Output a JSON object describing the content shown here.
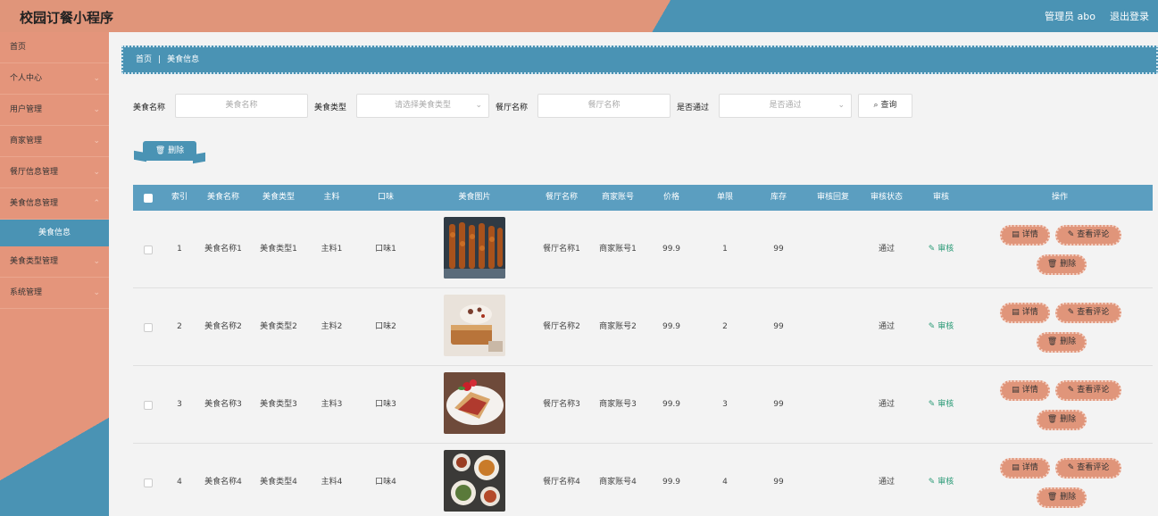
{
  "header": {
    "title": "校园订餐小程序",
    "admin": "管理员 abo",
    "logout": "退出登录"
  },
  "sidebar": {
    "items": [
      {
        "label": "首页",
        "chevron": false
      },
      {
        "label": "个人中心",
        "chevron": true
      },
      {
        "label": "用户管理",
        "chevron": true
      },
      {
        "label": "商家管理",
        "chevron": true
      },
      {
        "label": "餐厅信息管理",
        "chevron": true
      },
      {
        "label": "美食信息管理",
        "chevron": true
      }
    ],
    "active_sub": "美食信息",
    "items_after": [
      {
        "label": "美食类型管理",
        "chevron": true
      },
      {
        "label": "系统管理",
        "chevron": true
      }
    ]
  },
  "breadcrumb": {
    "home": "首页",
    "current": "美食信息"
  },
  "search": {
    "food_name_label": "美食名称",
    "food_name_placeholder": "美食名称",
    "food_type_label": "美食类型",
    "food_type_placeholder": "请选择美食类型",
    "restaurant_label": "餐厅名称",
    "restaurant_placeholder": "餐厅名称",
    "approved_label": "是否通过",
    "approved_placeholder": "是否通过",
    "query_label": "查询"
  },
  "delete_label": "删除",
  "table": {
    "headers": [
      "索引",
      "美食名称",
      "美食类型",
      "主料",
      "口味",
      "美食图片",
      "餐厅名称",
      "商家账号",
      "价格",
      "单限",
      "库存",
      "审核回复",
      "审核状态",
      "审核",
      "操作"
    ],
    "audit_label": "审核",
    "detail_label": "详情",
    "review_label": "查看评论",
    "delete_label": "删除",
    "rows": [
      {
        "index": "1",
        "name": "美食名称1",
        "type": "美食类型1",
        "main": "主料1",
        "taste": "口味1",
        "restaurant": "餐厅名称1",
        "account": "商家账号1",
        "price": "99.9",
        "limit": "1",
        "stock": "99",
        "reply": "",
        "status": "通过"
      },
      {
        "index": "2",
        "name": "美食名称2",
        "type": "美食类型2",
        "main": "主料2",
        "taste": "口味2",
        "restaurant": "餐厅名称2",
        "account": "商家账号2",
        "price": "99.9",
        "limit": "2",
        "stock": "99",
        "reply": "",
        "status": "通过"
      },
      {
        "index": "3",
        "name": "美食名称3",
        "type": "美食类型3",
        "main": "主料3",
        "taste": "口味3",
        "restaurant": "餐厅名称3",
        "account": "商家账号3",
        "price": "99.9",
        "limit": "3",
        "stock": "99",
        "reply": "",
        "status": "通过"
      },
      {
        "index": "4",
        "name": "美食名称4",
        "type": "美食类型4",
        "main": "主料4",
        "taste": "口味4",
        "restaurant": "餐厅名称4",
        "account": "商家账号4",
        "price": "99.9",
        "limit": "4",
        "stock": "99",
        "reply": "",
        "status": "通过"
      }
    ]
  },
  "icons": {
    "search": "search-icon",
    "chevron": "chevron-down-icon",
    "delete": "trash-icon",
    "detail": "document-icon",
    "edit": "pencil-icon"
  },
  "colors": {
    "primary_blue": "#4a93b4",
    "accent_salmon": "#e0957a",
    "audit_green": "#2a9a76"
  }
}
